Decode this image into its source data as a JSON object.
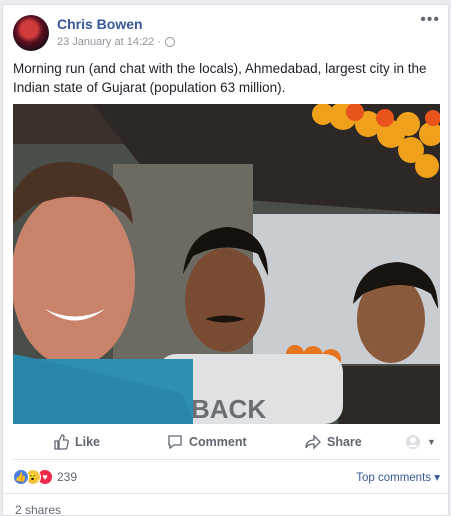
{
  "post": {
    "author": "Chris Bowen",
    "timestamp": "23 January at 14:22 ·",
    "text": "Morning run (and chat with the locals), Ahmedabad, largest city in the Indian state of Gujarat (population 63 million).",
    "photo_text": "BACK"
  },
  "actions": {
    "like": "Like",
    "comment": "Comment",
    "share": "Share"
  },
  "reactions": {
    "count": "239",
    "sort_label": "Top comments ▾"
  },
  "shares": "2 shares",
  "colors": {
    "link": "#365899",
    "like_blue": "#4d7ee3",
    "love_red": "#f0284a",
    "wow_yellow": "#f2c94c"
  }
}
